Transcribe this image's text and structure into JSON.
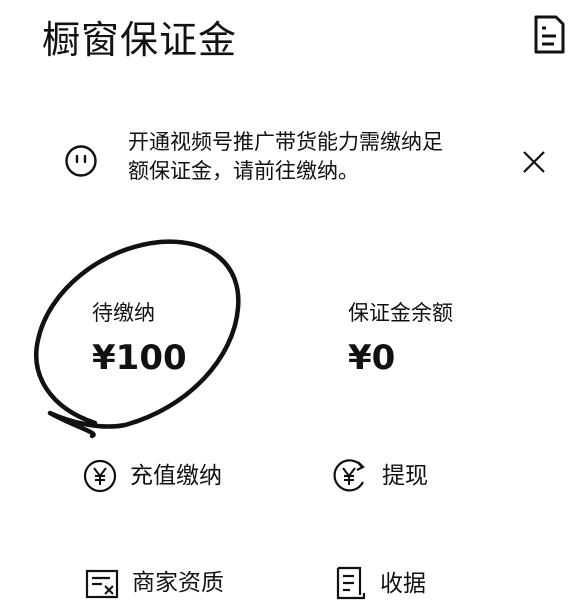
{
  "header": {
    "title": "橱窗保证金",
    "record_icon": "document-list-icon"
  },
  "notice": {
    "icon": "face-icon",
    "line1": "开通视频号推广带货能力需缴纳足",
    "line2": "额保证金，请前往缴纳。",
    "close_icon": "close-icon"
  },
  "balances": {
    "pending_label": "待缴纳",
    "pending_value": "¥100",
    "deposit_label": "保证金余额",
    "deposit_value": "¥0"
  },
  "actions": {
    "recharge_label": "充值缴纳",
    "withdraw_label": "提现",
    "merchant_label": "商家资质",
    "receipt_label": "收据"
  },
  "colors": {
    "text": "#111111",
    "background": "#ffffff"
  }
}
